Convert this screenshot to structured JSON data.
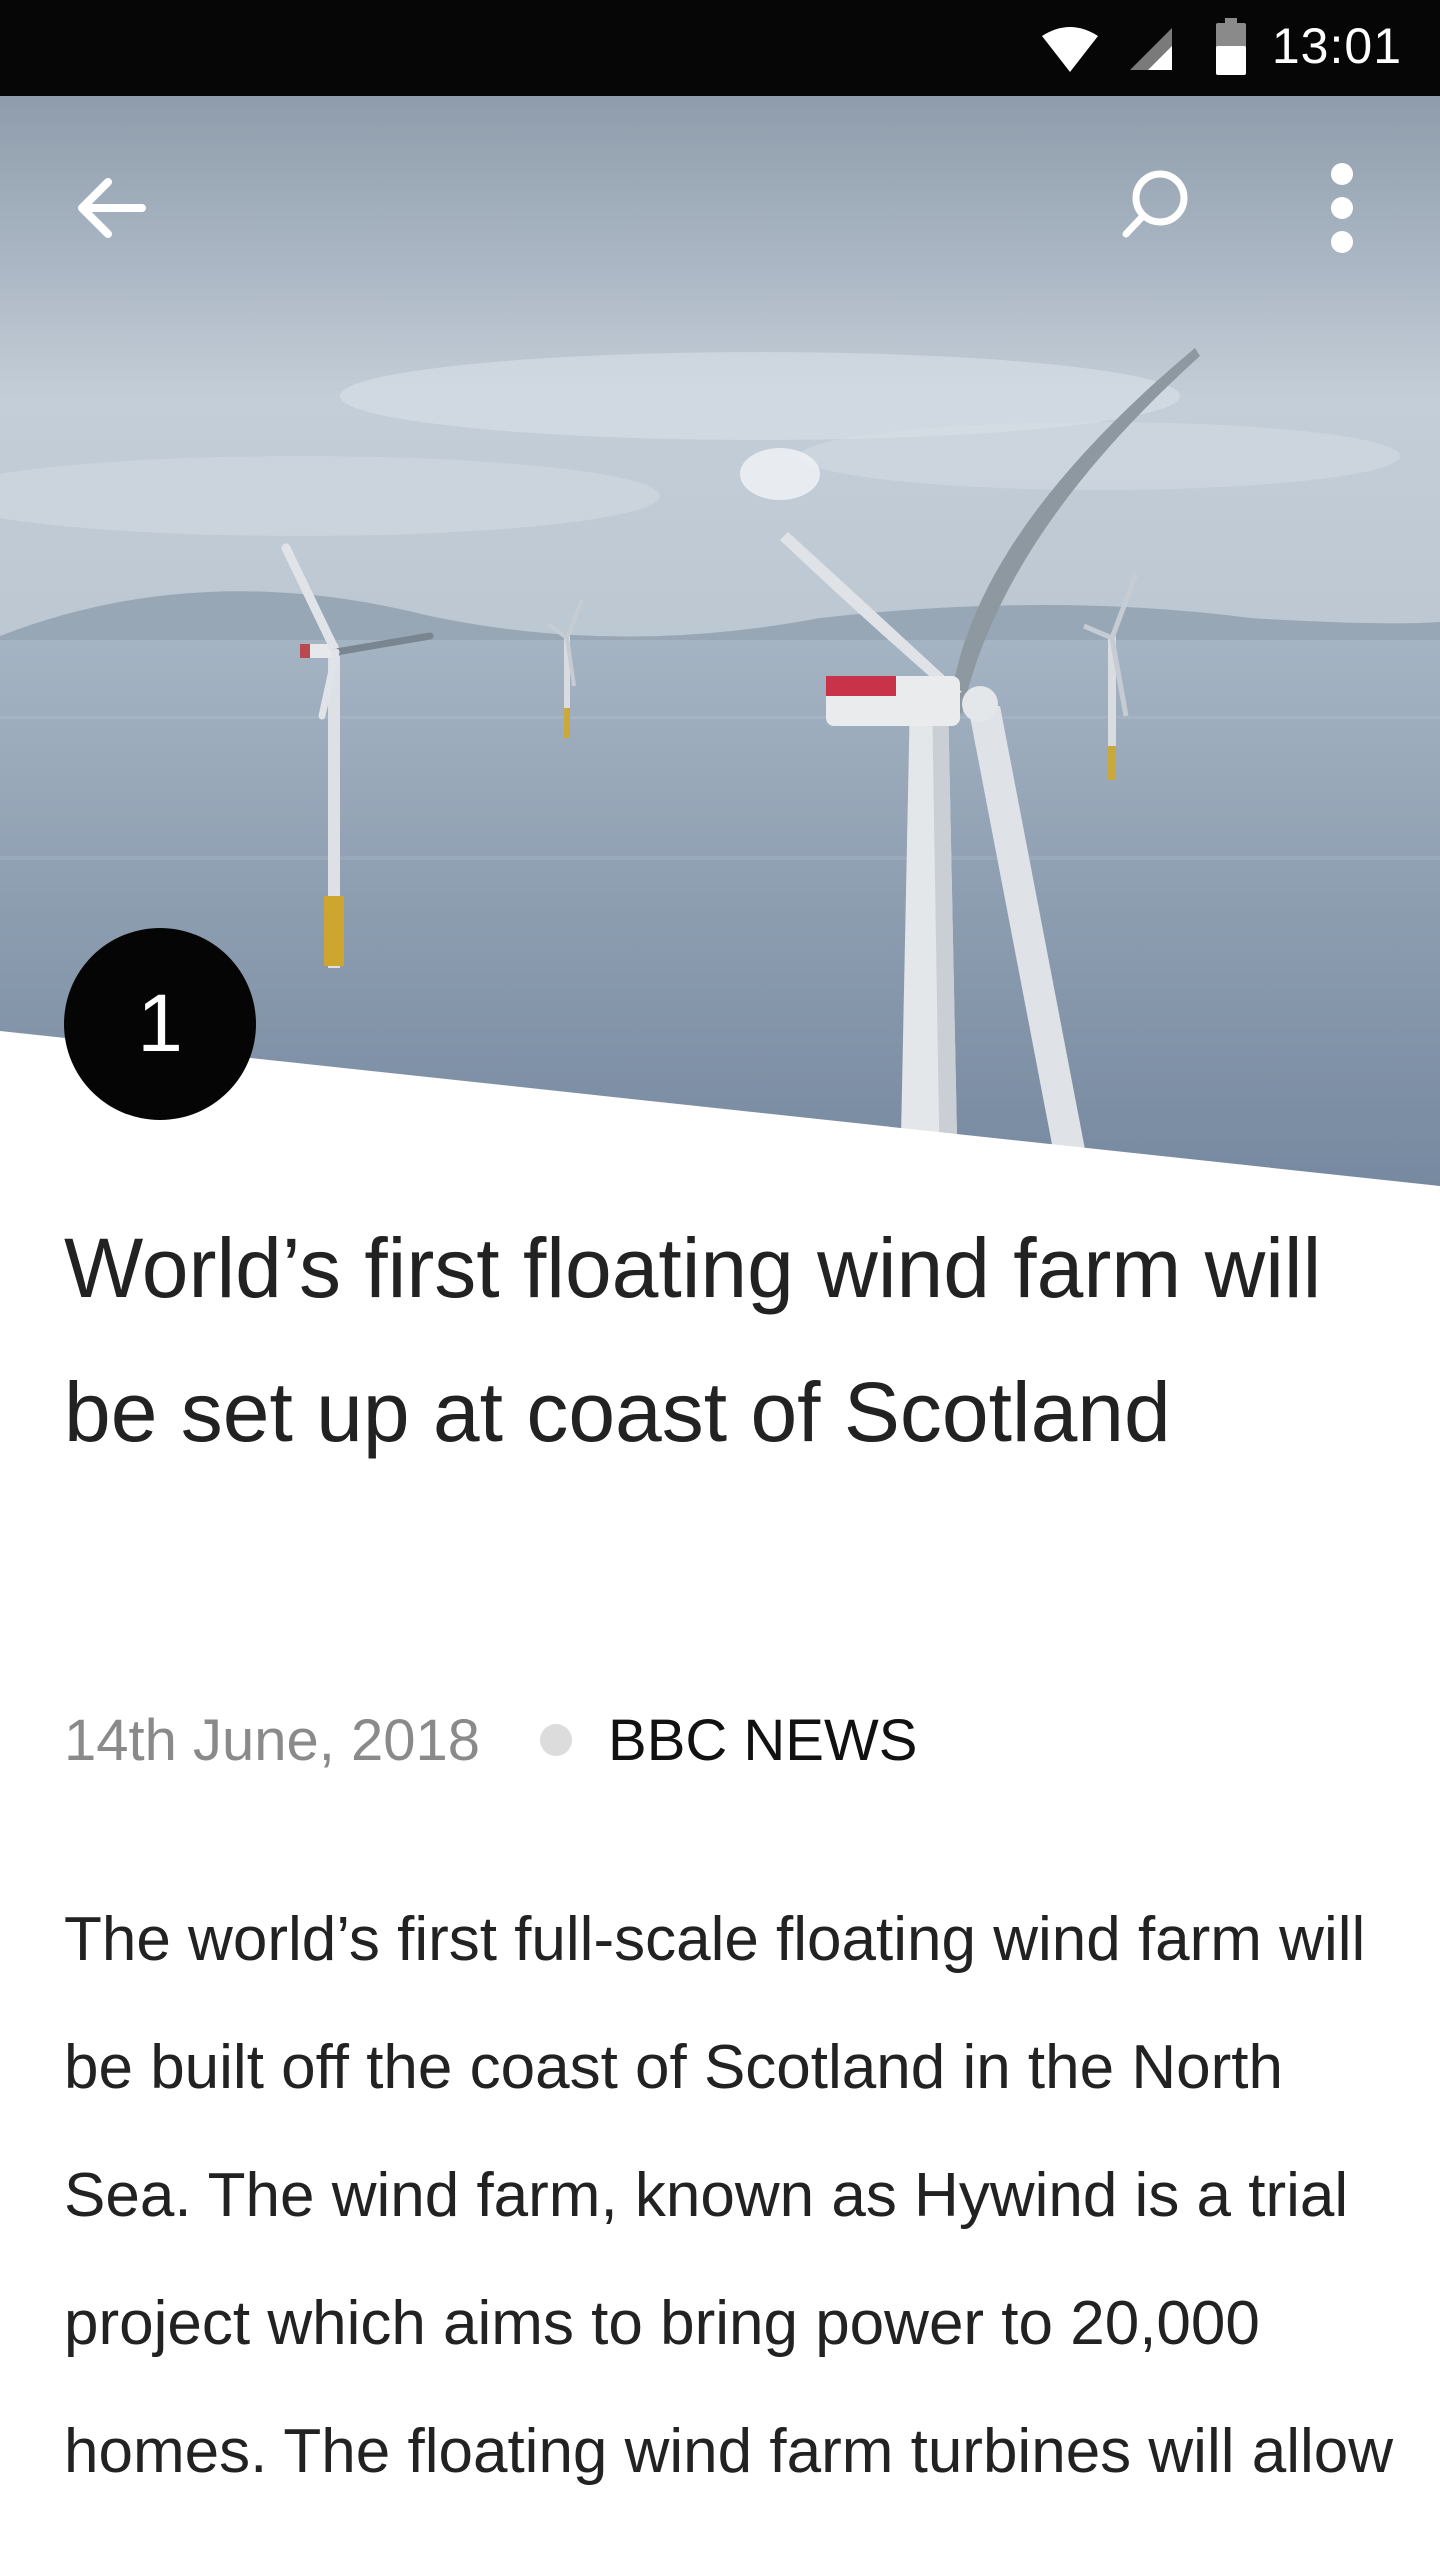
{
  "status_bar": {
    "time": "13:01",
    "icons": [
      "wifi-icon",
      "cell-signal-icon",
      "battery-icon"
    ]
  },
  "toolbar": {
    "back_icon": "arrow-left-icon",
    "search_icon": "search-icon",
    "more_icon": "more-vert-icon"
  },
  "article": {
    "rank": "1",
    "title": "World’s first floating wind farm will be set up at coast of Scotland",
    "date": "14th June, 2018",
    "source": "BBC NEWS",
    "body": "The world’s first full-scale floating wind farm will be built off the coast of Scotland in the North Sea. The wind farm, known as Hywind is a trial project which aims to bring power to 20,000 homes. The floating wind farm turbines will allow"
  },
  "colors": {
    "status_bar_bg": "#060606",
    "badge_bg": "#050505",
    "text_primary": "#222222",
    "text_secondary": "#8a8a8a",
    "dot": "#dcdcdc"
  }
}
